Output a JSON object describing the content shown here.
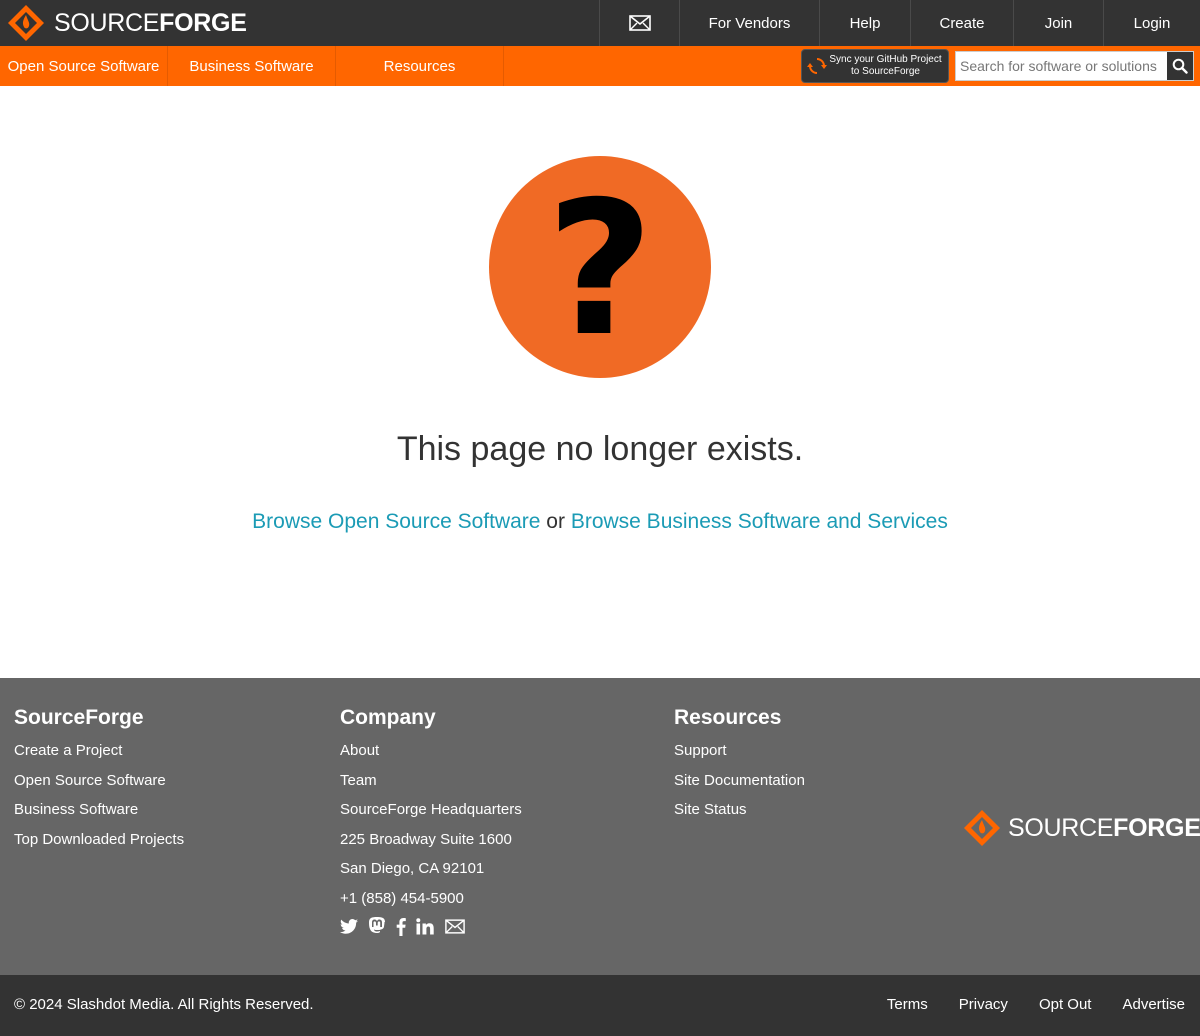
{
  "header": {
    "logo_light": "SOURCE",
    "logo_bold": "FORGE",
    "mail_icon": "envelope-icon",
    "nav": [
      "For Vendors",
      "Help",
      "Create",
      "Join",
      "Login"
    ]
  },
  "subnav": {
    "items": [
      "Open Source Software",
      "Business Software",
      "Resources"
    ],
    "sync_line1": "Sync your GitHub Project",
    "sync_line2": "to SourceForge",
    "search_placeholder": "Search for software or solutions",
    "search_icon": "search-icon"
  },
  "main": {
    "icon": "question-mark-icon",
    "question_glyph": "?",
    "message": "This page no longer exists.",
    "link1": "Browse Open Source Software",
    "or": "or",
    "link2": "Browse Business Software and Services"
  },
  "footer": {
    "col1": {
      "title": "SourceForge",
      "links": [
        "Create a Project",
        "Open Source Software",
        "Business Software",
        "Top Downloaded Projects"
      ]
    },
    "col2": {
      "title": "Company",
      "links": [
        "About",
        "Team",
        "SourceForge Headquarters",
        "225 Broadway Suite 1600",
        "San Diego, CA 92101",
        "+1 (858) 454-5900"
      ]
    },
    "col3": {
      "title": "Resources",
      "links": [
        "Support",
        "Site Documentation",
        "Site Status"
      ]
    },
    "social_icons": [
      "twitter-icon",
      "mastodon-icon",
      "facebook-icon",
      "linkedin-icon",
      "envelope-icon"
    ],
    "copyright": "© 2024 Slashdot Media. All Rights Reserved.",
    "bottom_links": [
      "Terms",
      "Privacy",
      "Opt Out",
      "Advertise"
    ]
  },
  "colors": {
    "orange": "#ff6600",
    "dark": "#333333",
    "footer_gray": "#666666",
    "link_teal": "#1b9bb5",
    "question_circle": "#f06a25"
  }
}
